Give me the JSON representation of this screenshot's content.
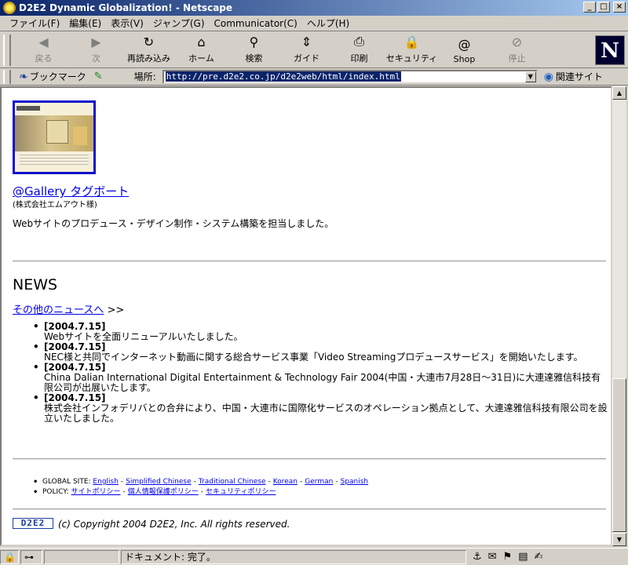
{
  "window": {
    "title": "D2E2 Dynamic Globalization! - Netscape",
    "buttons": [
      "_",
      "□",
      "×"
    ]
  },
  "menu": [
    "ファイル(F)",
    "編集(E)",
    "表示(V)",
    "ジャンプ(G)",
    "Communicator(C)",
    "ヘルプ(H)"
  ],
  "toolbar": [
    {
      "label": "戻る",
      "icon": "back-arrow-icon",
      "glyph": "◀",
      "disabled": true
    },
    {
      "label": "次",
      "icon": "forward-arrow-icon",
      "glyph": "▶",
      "disabled": true
    },
    {
      "label": "再読み込み",
      "icon": "reload-icon",
      "glyph": "↻",
      "disabled": false
    },
    {
      "label": "ホーム",
      "icon": "home-icon",
      "glyph": "⌂",
      "disabled": false
    },
    {
      "label": "検索",
      "icon": "search-icon",
      "glyph": "⚲",
      "disabled": false
    },
    {
      "label": "ガイド",
      "icon": "guide-icon",
      "glyph": "⇕",
      "disabled": false
    },
    {
      "label": "印刷",
      "icon": "print-icon",
      "glyph": "⎙",
      "disabled": false
    },
    {
      "label": "セキュリティ",
      "icon": "security-lock-icon",
      "glyph": "🔒",
      "disabled": false
    },
    {
      "label": "Shop",
      "icon": "shop-icon",
      "glyph": "@",
      "disabled": false
    },
    {
      "label": "停止",
      "icon": "stop-icon",
      "glyph": "⊘",
      "disabled": true
    }
  ],
  "brand_logo": "N",
  "locationbar": {
    "bookmarks_label": "ブックマーク",
    "location_label": "場所:",
    "url": "http://pre.d2e2.co.jp/d2e2web/html/index.html",
    "related_label": "関連サイト"
  },
  "content": {
    "gallery_link": "@Gallery タグボート",
    "company": "(株式会社エムアウト様)",
    "description": "Webサイトのプロデュース・デザイン制作・システム構築を担当しました。",
    "news_heading": "NEWS",
    "more_news_link": "その他のニュースへ",
    "more_news_suffix": " >>",
    "news": [
      {
        "date": "[2004.7.15]",
        "text": "Webサイトを全面リニューアルいたしました。"
      },
      {
        "date": "[2004.7.15]",
        "text": "NEC様と共同でインターネット動画に関する総合サービス事業「Video Streamingプロデュースサービス」を開始いたします。"
      },
      {
        "date": "[2004.7.15]",
        "text": "China Dalian International Digital Entertainment & Technology Fair 2004(中国・大連市7月28日～31日)に大連達雅信科技有限公司が出展いたします。"
      },
      {
        "date": "[2004.7.15]",
        "text": "株式会社インフォデリバとの合弁により、中国・大連市に国際化サービスのオペレーション拠点として、大連達雅信科技有限公司を設立いたしました。"
      }
    ],
    "global_site_label": "GLOBAL SITE:",
    "global_sites": [
      "English",
      "Simplified Chinese",
      "Traditional Chinese",
      "Korean",
      "German",
      "Spanish"
    ],
    "policy_label": "POLICY:",
    "policies": [
      "サイトポリシー",
      "個人情報保護ポリシー",
      "セキュリティポリシー"
    ],
    "separator": "-",
    "logo_text": "D2E2",
    "copyright": "(c) Copyright 2004 D2E2, Inc. All rights reserved."
  },
  "status": {
    "text": "ドキュメント: 完了。"
  }
}
